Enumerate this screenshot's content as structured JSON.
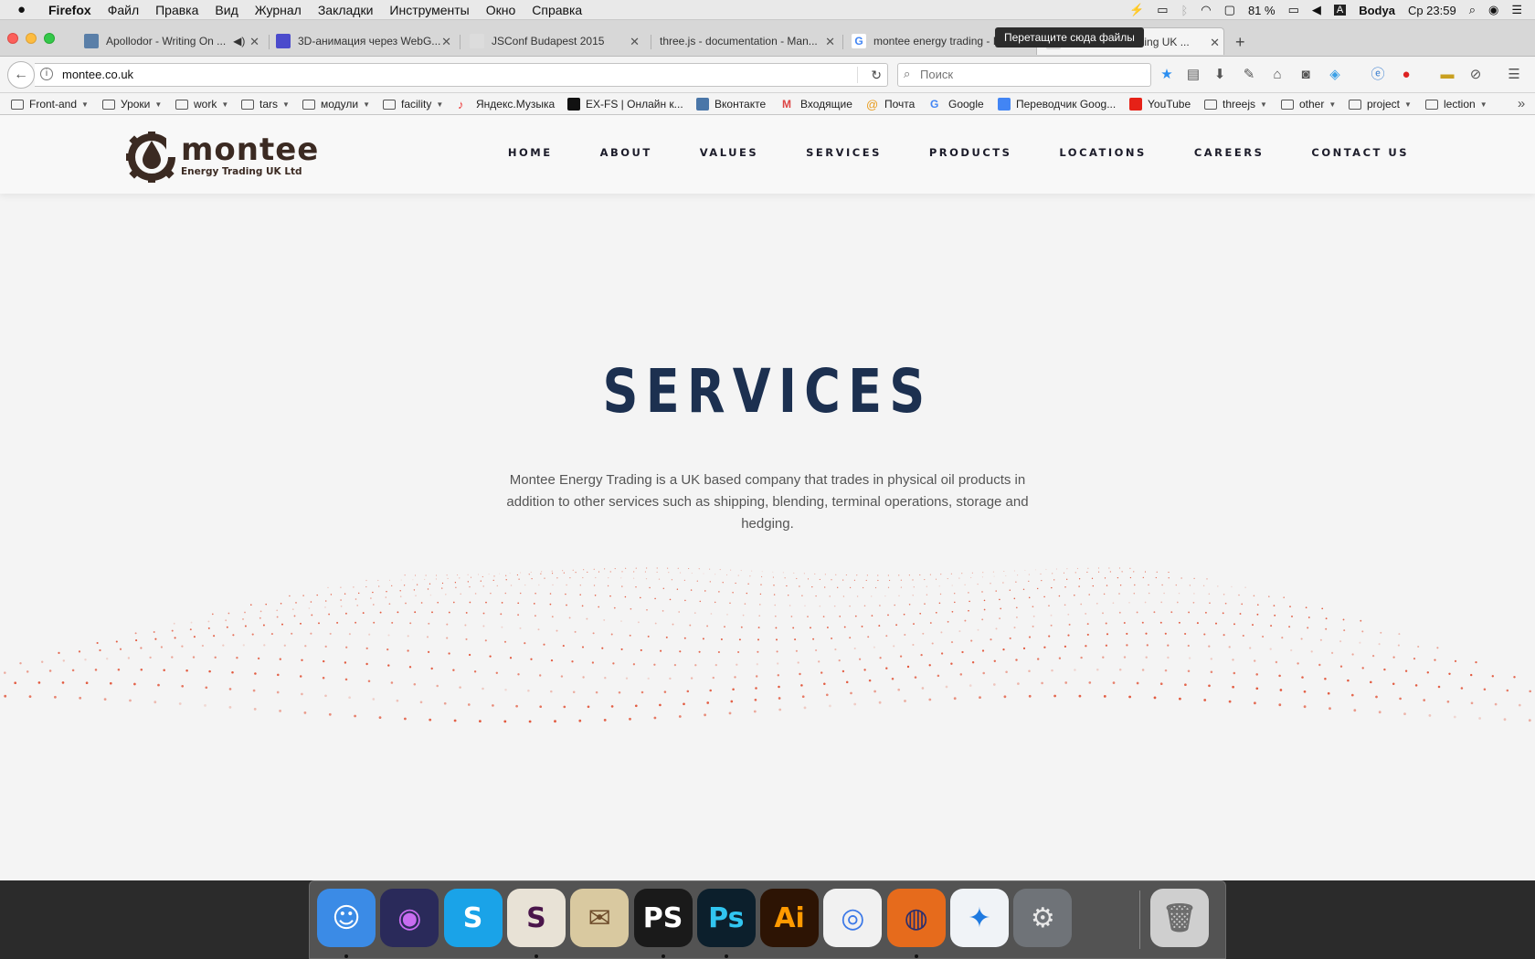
{
  "menubar": {
    "app": "Firefox",
    "items": [
      "Файл",
      "Правка",
      "Вид",
      "Журнал",
      "Закладки",
      "Инструменты",
      "Окно",
      "Справка"
    ],
    "battery": "81 %",
    "user": "Bodya",
    "clock": "Ср 23:59",
    "input_source": "A"
  },
  "tabs": [
    {
      "title": "Apollodor - Writing On ...",
      "favicon_color": "#5a7fa8"
    },
    {
      "title": "3D-анимация через WebG...",
      "favicon_color": "#4b4bcc"
    },
    {
      "title": "JSConf Budapest 2015",
      "favicon_color": "#cfcfcf"
    },
    {
      "title": "three.js - documentation - Man...",
      "favicon_color": "#cfcfcf"
    },
    {
      "title": "montee energy trading - I",
      "favicon_color": "#ffffff"
    },
    {
      "title": "...ading UK ...",
      "favicon_color": "#cfcfcf"
    }
  ],
  "tooltip": "Перетащите сюда файлы",
  "navigation": {
    "url": "montee.co.uk",
    "search_placeholder": "Поиск"
  },
  "bookmarks": [
    {
      "label": "Front-and",
      "type": "folder"
    },
    {
      "label": "Уроки",
      "type": "folder"
    },
    {
      "label": "work",
      "type": "folder"
    },
    {
      "label": "tars",
      "type": "folder"
    },
    {
      "label": "модули",
      "type": "folder"
    },
    {
      "label": "facility",
      "type": "folder"
    },
    {
      "label": "Яндекс.Музыка",
      "type": "link"
    },
    {
      "label": "EX-FS | Онлайн к...",
      "type": "link"
    },
    {
      "label": "Вконтакте",
      "type": "link"
    },
    {
      "label": "Входящие",
      "type": "link"
    },
    {
      "label": "Почта",
      "type": "link"
    },
    {
      "label": "Google",
      "type": "link"
    },
    {
      "label": "Переводчик Goog...",
      "type": "link"
    },
    {
      "label": "YouTube",
      "type": "link"
    },
    {
      "label": "threejs",
      "type": "folder"
    },
    {
      "label": "other",
      "type": "folder"
    },
    {
      "label": "project",
      "type": "folder"
    },
    {
      "label": "lection",
      "type": "folder"
    }
  ],
  "site": {
    "logo_word": "montee",
    "logo_tagline": "Energy Trading UK Ltd",
    "nav": [
      "HOME",
      "ABOUT",
      "VALUES",
      "SERVICES",
      "PRODUCTS",
      "LOCATIONS",
      "CAREERS",
      "CONTACT US"
    ],
    "hero_title": "SERVICES",
    "hero_text": "Montee Energy Trading is a UK based company that trades in physical oil products in addition to other services such as shipping, blending, terminal operations, storage and hedging.",
    "dot_color": "#e0482a",
    "brand_color": "#3b2a22",
    "title_color": "#1c3050"
  },
  "dock": {
    "items": [
      {
        "name": "Finder",
        "glyph": "☺",
        "bg": "#3b8be6",
        "fg": "#ffffff"
      },
      {
        "name": "Siri",
        "glyph": "◉",
        "bg": "#2a2a5a",
        "fg": "#c86cf0"
      },
      {
        "name": "Skype",
        "glyph": "S",
        "bg": "#1aa3e8",
        "fg": "#ffffff"
      },
      {
        "name": "Slack",
        "glyph": "S",
        "bg": "#e8e2d6",
        "fg": "#4a154b"
      },
      {
        "name": "Mail",
        "glyph": "✉",
        "bg": "#d9c9a0",
        "fg": "#6d4b2a"
      },
      {
        "name": "PhpStorm",
        "glyph": "PS",
        "bg": "#1a1a1a",
        "fg": "#ffffff"
      },
      {
        "name": "Photoshop",
        "glyph": "Ps",
        "bg": "#0c1f2c",
        "fg": "#31c5f0"
      },
      {
        "name": "Illustrator",
        "glyph": "Ai",
        "bg": "#2d1404",
        "fg": "#ff9a00"
      },
      {
        "name": "Chrome",
        "glyph": "◎",
        "bg": "#f1f1f1",
        "fg": "#3b78e7"
      },
      {
        "name": "Firefox",
        "glyph": "◍",
        "bg": "#e66b1c",
        "fg": "#2b2f6e"
      },
      {
        "name": "Safari",
        "glyph": "✦",
        "bg": "#f0f3f7",
        "fg": "#1f7ae0"
      },
      {
        "name": "System Preferences",
        "glyph": "⚙",
        "bg": "#6f7378",
        "fg": "#e8e8e8"
      },
      {
        "name": "Trash",
        "glyph": "🗑",
        "bg": "#cfcfcf",
        "fg": "#6d6d6d"
      }
    ]
  }
}
